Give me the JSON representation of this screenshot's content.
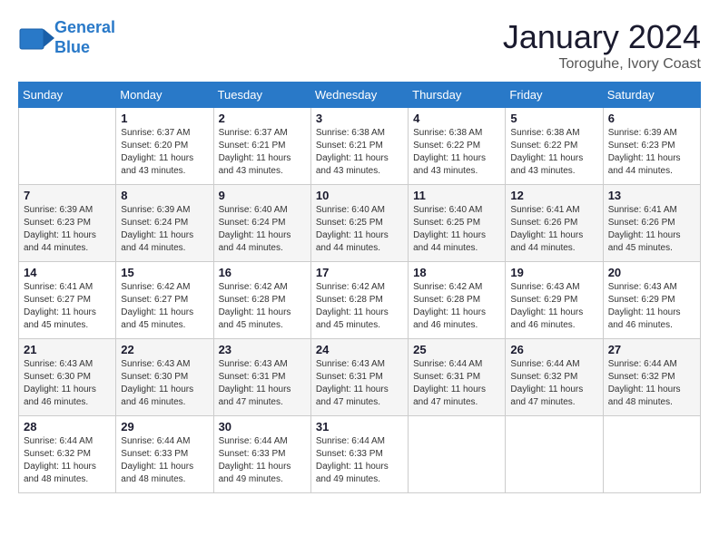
{
  "header": {
    "logo_line1": "General",
    "logo_line2": "Blue",
    "month": "January 2024",
    "location": "Toroguhe, Ivory Coast"
  },
  "weekdays": [
    "Sunday",
    "Monday",
    "Tuesday",
    "Wednesday",
    "Thursday",
    "Friday",
    "Saturday"
  ],
  "weeks": [
    [
      {
        "day": "",
        "sunrise": "",
        "sunset": "",
        "daylight": ""
      },
      {
        "day": "1",
        "sunrise": "6:37 AM",
        "sunset": "6:20 PM",
        "daylight": "11 hours and 43 minutes."
      },
      {
        "day": "2",
        "sunrise": "6:37 AM",
        "sunset": "6:21 PM",
        "daylight": "11 hours and 43 minutes."
      },
      {
        "day": "3",
        "sunrise": "6:38 AM",
        "sunset": "6:21 PM",
        "daylight": "11 hours and 43 minutes."
      },
      {
        "day": "4",
        "sunrise": "6:38 AM",
        "sunset": "6:22 PM",
        "daylight": "11 hours and 43 minutes."
      },
      {
        "day": "5",
        "sunrise": "6:38 AM",
        "sunset": "6:22 PM",
        "daylight": "11 hours and 43 minutes."
      },
      {
        "day": "6",
        "sunrise": "6:39 AM",
        "sunset": "6:23 PM",
        "daylight": "11 hours and 44 minutes."
      }
    ],
    [
      {
        "day": "7",
        "sunrise": "6:39 AM",
        "sunset": "6:23 PM",
        "daylight": "11 hours and 44 minutes."
      },
      {
        "day": "8",
        "sunrise": "6:39 AM",
        "sunset": "6:24 PM",
        "daylight": "11 hours and 44 minutes."
      },
      {
        "day": "9",
        "sunrise": "6:40 AM",
        "sunset": "6:24 PM",
        "daylight": "11 hours and 44 minutes."
      },
      {
        "day": "10",
        "sunrise": "6:40 AM",
        "sunset": "6:25 PM",
        "daylight": "11 hours and 44 minutes."
      },
      {
        "day": "11",
        "sunrise": "6:40 AM",
        "sunset": "6:25 PM",
        "daylight": "11 hours and 44 minutes."
      },
      {
        "day": "12",
        "sunrise": "6:41 AM",
        "sunset": "6:26 PM",
        "daylight": "11 hours and 44 minutes."
      },
      {
        "day": "13",
        "sunrise": "6:41 AM",
        "sunset": "6:26 PM",
        "daylight": "11 hours and 45 minutes."
      }
    ],
    [
      {
        "day": "14",
        "sunrise": "6:41 AM",
        "sunset": "6:27 PM",
        "daylight": "11 hours and 45 minutes."
      },
      {
        "day": "15",
        "sunrise": "6:42 AM",
        "sunset": "6:27 PM",
        "daylight": "11 hours and 45 minutes."
      },
      {
        "day": "16",
        "sunrise": "6:42 AM",
        "sunset": "6:28 PM",
        "daylight": "11 hours and 45 minutes."
      },
      {
        "day": "17",
        "sunrise": "6:42 AM",
        "sunset": "6:28 PM",
        "daylight": "11 hours and 45 minutes."
      },
      {
        "day": "18",
        "sunrise": "6:42 AM",
        "sunset": "6:28 PM",
        "daylight": "11 hours and 46 minutes."
      },
      {
        "day": "19",
        "sunrise": "6:43 AM",
        "sunset": "6:29 PM",
        "daylight": "11 hours and 46 minutes."
      },
      {
        "day": "20",
        "sunrise": "6:43 AM",
        "sunset": "6:29 PM",
        "daylight": "11 hours and 46 minutes."
      }
    ],
    [
      {
        "day": "21",
        "sunrise": "6:43 AM",
        "sunset": "6:30 PM",
        "daylight": "11 hours and 46 minutes."
      },
      {
        "day": "22",
        "sunrise": "6:43 AM",
        "sunset": "6:30 PM",
        "daylight": "11 hours and 46 minutes."
      },
      {
        "day": "23",
        "sunrise": "6:43 AM",
        "sunset": "6:31 PM",
        "daylight": "11 hours and 47 minutes."
      },
      {
        "day": "24",
        "sunrise": "6:43 AM",
        "sunset": "6:31 PM",
        "daylight": "11 hours and 47 minutes."
      },
      {
        "day": "25",
        "sunrise": "6:44 AM",
        "sunset": "6:31 PM",
        "daylight": "11 hours and 47 minutes."
      },
      {
        "day": "26",
        "sunrise": "6:44 AM",
        "sunset": "6:32 PM",
        "daylight": "11 hours and 47 minutes."
      },
      {
        "day": "27",
        "sunrise": "6:44 AM",
        "sunset": "6:32 PM",
        "daylight": "11 hours and 48 minutes."
      }
    ],
    [
      {
        "day": "28",
        "sunrise": "6:44 AM",
        "sunset": "6:32 PM",
        "daylight": "11 hours and 48 minutes."
      },
      {
        "day": "29",
        "sunrise": "6:44 AM",
        "sunset": "6:33 PM",
        "daylight": "11 hours and 48 minutes."
      },
      {
        "day": "30",
        "sunrise": "6:44 AM",
        "sunset": "6:33 PM",
        "daylight": "11 hours and 49 minutes."
      },
      {
        "day": "31",
        "sunrise": "6:44 AM",
        "sunset": "6:33 PM",
        "daylight": "11 hours and 49 minutes."
      },
      {
        "day": "",
        "sunrise": "",
        "sunset": "",
        "daylight": ""
      },
      {
        "day": "",
        "sunrise": "",
        "sunset": "",
        "daylight": ""
      },
      {
        "day": "",
        "sunrise": "",
        "sunset": "",
        "daylight": ""
      }
    ]
  ],
  "labels": {
    "sunrise_prefix": "Sunrise: ",
    "sunset_prefix": "Sunset: ",
    "daylight_prefix": "Daylight: "
  }
}
